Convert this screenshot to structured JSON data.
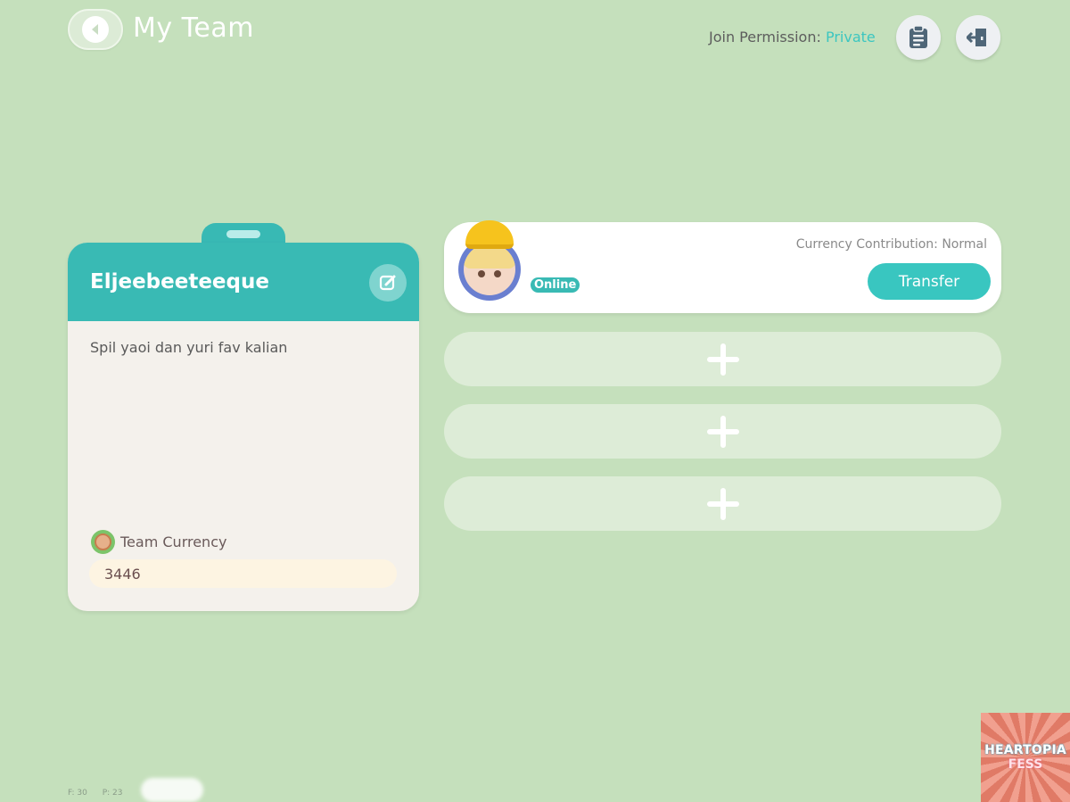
{
  "header": {
    "title": "My Team",
    "join_permission_label": "Join Permission:",
    "join_permission_value": "Private"
  },
  "team": {
    "name": "Eljeebeeteeque",
    "description": "Spil yaoi dan yuri fav kalian",
    "currency_label": "Team Currency",
    "currency_value": "3446"
  },
  "members": [
    {
      "status": "Online",
      "contribution": "Currency Contribution: Normal",
      "transfer_label": "Transfer"
    }
  ],
  "empty_slots": [
    "+",
    "+",
    "+"
  ],
  "footer": {
    "fps": "F: 30",
    "ping": "P: 23"
  },
  "watermark": {
    "line1": "HEARTOPIA",
    "line2": "FESS"
  },
  "colors": {
    "background": "#c5e0bc",
    "accent_teal": "#39bab4",
    "private_text": "#3cc6c0"
  },
  "icons": [
    "back-arrow-icon",
    "clipboard-icon",
    "exit-door-icon",
    "edit-icon",
    "coin-icon",
    "plus-icon"
  ]
}
